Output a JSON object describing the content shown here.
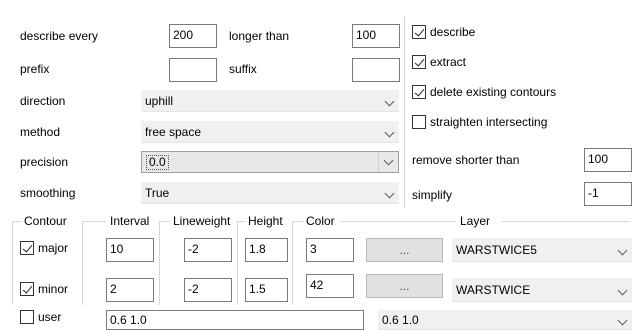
{
  "left_panel": {
    "describe_every_label": "describe every",
    "describe_every_value": "200",
    "longer_than_label": "longer than",
    "longer_than_value": "100",
    "prefix_label": "prefix",
    "prefix_value": "",
    "suffix_label": "suffix",
    "suffix_value": "",
    "direction_label": "direction",
    "direction_value": "uphill",
    "method_label": "method",
    "method_value": "free space",
    "precision_label": "precision",
    "precision_value": "0.0",
    "smoothing_label": "smoothing",
    "smoothing_value": "True"
  },
  "right_panel": {
    "describe": {
      "label": "describe",
      "checked": true
    },
    "extract": {
      "label": "extract",
      "checked": true
    },
    "delete_existing": {
      "label": "delete existing contours",
      "checked": true
    },
    "straighten": {
      "label": "straighten intersecting",
      "checked": false
    },
    "remove_shorter_label": "remove shorter than",
    "remove_shorter_value": "100",
    "simplify_label": "simplify",
    "simplify_value": "-1"
  },
  "contours": {
    "headers": {
      "contour": "Contour",
      "interval": "Interval",
      "lineweight": "Lineweight",
      "height": "Height",
      "color": "Color",
      "layer": "Layer"
    },
    "rows": [
      {
        "label": "major",
        "checked": true,
        "interval": "10",
        "lineweight": "-2",
        "height": "1.8",
        "color": "3",
        "button": "...",
        "layer": "WARSTWICE5"
      },
      {
        "label": "minor",
        "checked": true,
        "interval": "2",
        "lineweight": "-2",
        "height": "1.5",
        "color": "42",
        "button": "...",
        "layer": "WARSTWICE"
      }
    ],
    "user": {
      "label": "user",
      "checked": false,
      "values": "0.6 1.0",
      "dropdown_value": "0.6 1.0"
    }
  }
}
